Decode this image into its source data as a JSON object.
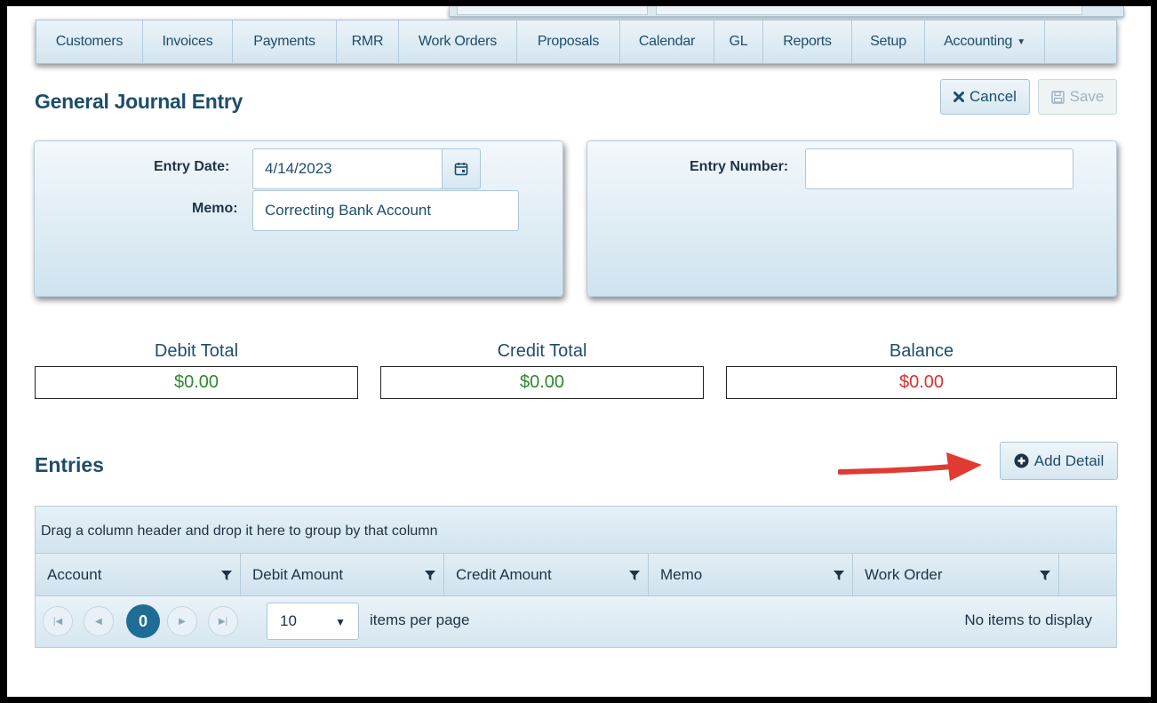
{
  "nav": {
    "items": [
      {
        "label": "Customers"
      },
      {
        "label": "Invoices"
      },
      {
        "label": "Payments"
      },
      {
        "label": "RMR"
      },
      {
        "label": "Work Orders"
      },
      {
        "label": "Proposals"
      },
      {
        "label": "Calendar"
      },
      {
        "label": "GL"
      },
      {
        "label": "Reports"
      },
      {
        "label": "Setup"
      },
      {
        "label": "Accounting"
      }
    ]
  },
  "page": {
    "title": "General Journal Entry",
    "cancel_label": "Cancel",
    "save_label": "Save"
  },
  "form": {
    "entry_date_label": "Entry Date:",
    "entry_date_value": "4/14/2023",
    "memo_label": "Memo:",
    "memo_value": "Correcting Bank Account",
    "entry_number_label": "Entry Number:",
    "entry_number_value": ""
  },
  "totals": {
    "debit_label": "Debit Total",
    "debit_value": "$0.00",
    "credit_label": "Credit Total",
    "credit_value": "$0.00",
    "balance_label": "Balance",
    "balance_value": "$0.00",
    "colors": {
      "positive": "#2e8a2e",
      "balance": "#e03030"
    }
  },
  "entries": {
    "title": "Entries",
    "add_detail_label": "Add Detail",
    "group_hint": "Drag a column header and drop it here to group by that column",
    "columns": [
      "Account",
      "Debit Amount",
      "Credit Amount",
      "Memo",
      "Work Order"
    ],
    "pager": {
      "current_page": "0",
      "page_size": "10",
      "items_per_page_label": "items per page",
      "status": "No items to display"
    }
  },
  "theme": {
    "accent": "#1d4d6b",
    "pager_active": "#1f6d96",
    "arrow": "#e03a32"
  }
}
